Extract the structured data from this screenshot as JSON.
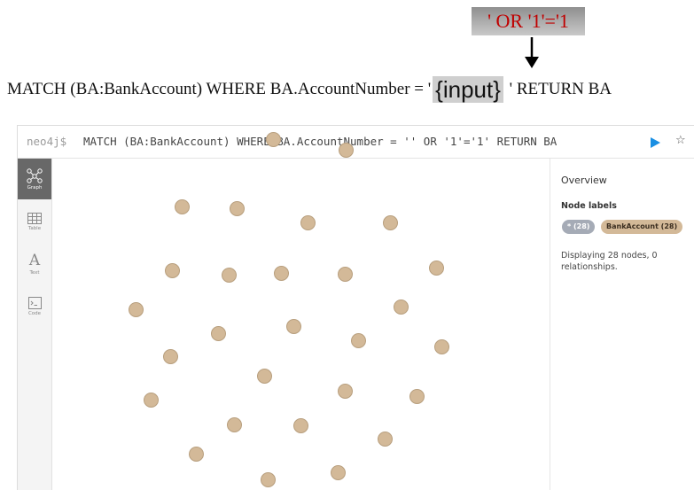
{
  "injection": {
    "payload": "' OR '1'='1",
    "query_prefix": "MATCH (BA:BankAccount) WHERE BA.AccountNumber = '",
    "input_token": "{input}",
    "query_suffix": " ' RETURN BA"
  },
  "editor": {
    "prompt": "neo4j$",
    "query": "MATCH (BA:BankAccount) WHERE BA.AccountNumber = '' OR '1'='1' RETURN BA",
    "run_icon": "play-icon",
    "favorite_icon": "star-icon"
  },
  "sidebar": {
    "items": [
      {
        "label": "Graph",
        "icon": "graph-icon",
        "active": true
      },
      {
        "label": "Table",
        "icon": "table-icon",
        "active": false
      },
      {
        "label": "Text",
        "icon": "text-icon",
        "active": false
      },
      {
        "label": "Code",
        "icon": "code-icon",
        "active": false
      }
    ]
  },
  "graph": {
    "node_label": "BankAccount",
    "node_color": "#d3b998",
    "node_count": 28
  },
  "overview": {
    "title": "Overview",
    "node_labels_heading": "Node labels",
    "all_badge": "* (28)",
    "label_badge": "BankAccount (28)",
    "status": "Displaying 28 nodes, 0 relationships."
  },
  "zoom_controls": [
    "zoom-in-icon",
    "zoom-out-icon",
    "fit-screen-icon"
  ]
}
